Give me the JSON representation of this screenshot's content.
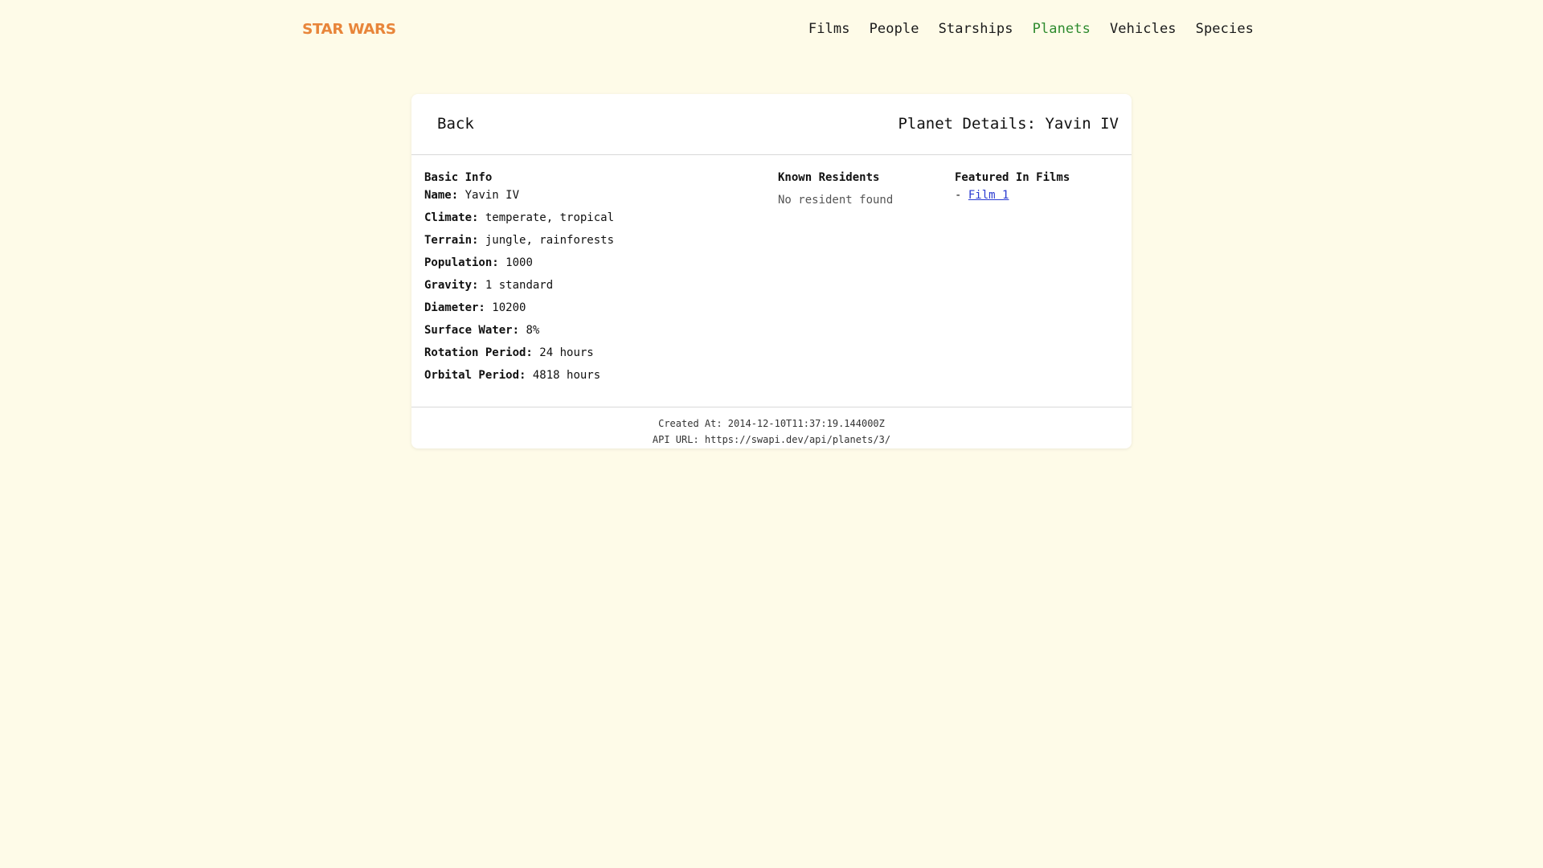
{
  "brand": "STAR WARS",
  "nav": {
    "films": "Films",
    "people": "People",
    "starships": "Starships",
    "planets": "Planets",
    "vehicles": "Vehicles",
    "species": "Species",
    "active": "Planets",
    "active_color": "#2e8b2e"
  },
  "header": {
    "back_label": "Back",
    "title": "Planet Details: Yavin IV"
  },
  "basic_info": {
    "heading": "Basic Info",
    "fields": [
      {
        "label": "Name:",
        "value": "Yavin IV"
      },
      {
        "label": "Climate:",
        "value": "temperate, tropical"
      },
      {
        "label": "Terrain:",
        "value": "jungle, rainforests"
      },
      {
        "label": "Population:",
        "value": "1000"
      },
      {
        "label": "Gravity:",
        "value": "1 standard"
      },
      {
        "label": "Diameter:",
        "value": "10200"
      },
      {
        "label": "Surface Water:",
        "value": "8%"
      },
      {
        "label": "Rotation Period:",
        "value": "24 hours"
      },
      {
        "label": "Orbital Period:",
        "value": "4818 hours"
      }
    ]
  },
  "residents": {
    "heading": "Known Residents",
    "empty_text": "No resident found"
  },
  "films": {
    "heading": "Featured In Films",
    "prefix": "-",
    "items": [
      {
        "label": "Film 1"
      }
    ]
  },
  "footer": {
    "created": "Created At: 2014-12-10T11:37:19.144000Z",
    "api_url": "API URL: https://swapi.dev/api/planets/3/"
  },
  "colors": {
    "background": "#fefbe8",
    "brand": "#e8853a",
    "link": "#2a3bd1"
  }
}
